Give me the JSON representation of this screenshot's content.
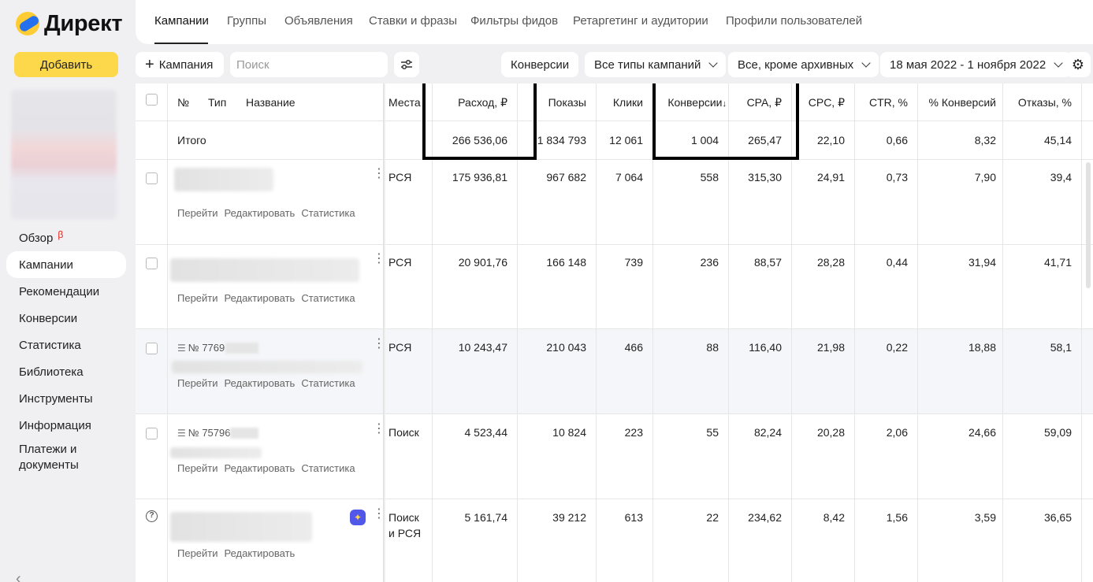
{
  "app": {
    "logo_text": "Директ"
  },
  "sidebar": {
    "add_label": "Добавить",
    "items": [
      {
        "label": "Обзор",
        "badge": "β"
      },
      {
        "label": "Кампании"
      },
      {
        "label": "Рекомендации"
      },
      {
        "label": "Конверсии"
      },
      {
        "label": "Статистика"
      },
      {
        "label": "Библиотека"
      },
      {
        "label": "Инструменты"
      },
      {
        "label": "Информация"
      },
      {
        "label": "Платежи и документы"
      }
    ]
  },
  "tabs": [
    "Кампании",
    "Группы",
    "Объявления",
    "Ставки и фразы",
    "Фильтры фидов",
    "Ретаргетинг и аудитории",
    "Профили пользователей"
  ],
  "toolbar": {
    "add_campaign_label": "Кампания",
    "search_placeholder": "Поиск",
    "conversions_label": "Конверсии",
    "campaign_types": "Все типы кампаний",
    "archive_filter": "Все, кроме архивных",
    "date_range": "18 мая 2022 - 1 ноября 2022"
  },
  "table": {
    "headers": {
      "num": "№",
      "type": "Тип",
      "name": "Название",
      "places": "Места",
      "spend": "Расход, ₽",
      "impressions": "Показы",
      "clicks": "Клики",
      "conversions": "Конверсии",
      "conversions_sort": "↓",
      "cpa": "CPA, ₽",
      "cpc": "CPC, ₽",
      "ctr": "CTR, %",
      "conv_rate": "% Конверсий",
      "bounces": "Отказы, %"
    },
    "total": {
      "label": "Итого",
      "spend": "266 536,06",
      "impressions": "1 834 793",
      "clicks": "12 061",
      "conversions": "1 004",
      "cpa": "265,47",
      "cpc": "22,10",
      "ctr": "0,66",
      "conv_rate": "8,32",
      "bounces": "45,14"
    },
    "links": {
      "go": "Перейти",
      "edit": "Редактировать",
      "stats": "Статистика"
    },
    "rows": [
      {
        "id": "",
        "places": "РСЯ",
        "places2": "",
        "spend": "175 936,81",
        "impressions": "967 682",
        "clicks": "7 064",
        "conversions": "558",
        "cpa": "315,30",
        "cpc": "24,91",
        "ctr": "0,73",
        "conv_rate": "7,90",
        "bounces": "39,4"
      },
      {
        "id": "",
        "places": "РСЯ",
        "places2": "",
        "spend": "20 901,76",
        "impressions": "166 148",
        "clicks": "739",
        "conversions": "236",
        "cpa": "88,57",
        "cpc": "28,28",
        "ctr": "0,44",
        "conv_rate": "31,94",
        "bounces": "41,71"
      },
      {
        "id": "№ 7769",
        "places": "РСЯ",
        "places2": "",
        "spend": "10 243,47",
        "impressions": "210 043",
        "clicks": "466",
        "conversions": "88",
        "cpa": "116,40",
        "cpc": "21,98",
        "ctr": "0,22",
        "conv_rate": "18,88",
        "bounces": "58,1"
      },
      {
        "id": "№ 75796",
        "places": "Поиск",
        "places2": "",
        "spend": "4 523,44",
        "impressions": "10 824",
        "clicks": "223",
        "conversions": "55",
        "cpa": "82,24",
        "cpc": "20,28",
        "ctr": "2,06",
        "conv_rate": "24,66",
        "bounces": "59,09"
      },
      {
        "id": "",
        "places": "Поиск",
        "places2": "и РСЯ",
        "spend": "5 161,74",
        "impressions": "39 212",
        "clicks": "613",
        "conversions": "22",
        "cpa": "234,62",
        "cpc": "8,42",
        "ctr": "1,56",
        "conv_rate": "3,59",
        "bounces": "36,65"
      }
    ]
  },
  "colors": {
    "accent_yellow": "#fcd84a",
    "highlight_border": "#000000",
    "beta_red": "#e0261b"
  }
}
